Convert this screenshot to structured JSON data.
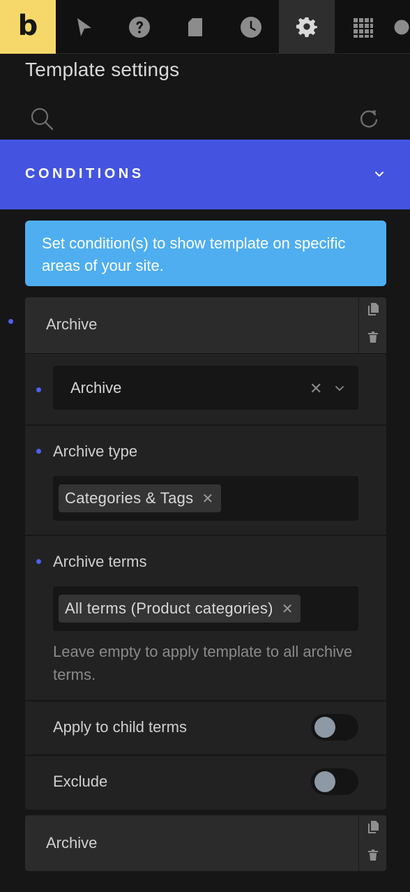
{
  "toolbar": {
    "logo": "b",
    "icons": [
      "pointer-icon",
      "help-icon",
      "page-icon",
      "history-icon",
      "settings-icon",
      "apps-grid-icon"
    ],
    "active": "settings-icon",
    "accent_logo": "#f6d86a"
  },
  "panel": {
    "title": "Template settings"
  },
  "section": {
    "title": "CONDITIONS",
    "color": "#4454e0"
  },
  "info": {
    "text": "Set condition(s) to show template on specific areas of your site.",
    "color": "#4faef0"
  },
  "conditions": [
    {
      "label": "Archive",
      "main_select": {
        "value": "Archive"
      },
      "archive_type": {
        "label": "Archive type",
        "tags": [
          "Categories & Tags"
        ]
      },
      "archive_terms": {
        "label": "Archive terms",
        "tags": [
          "All terms (Product categories)"
        ],
        "help": "Leave empty to apply template to all archive terms."
      },
      "apply_child": {
        "label": "Apply to child terms",
        "on": false
      },
      "exclude": {
        "label": "Exclude",
        "on": false
      }
    },
    {
      "label": "Archive"
    }
  ]
}
